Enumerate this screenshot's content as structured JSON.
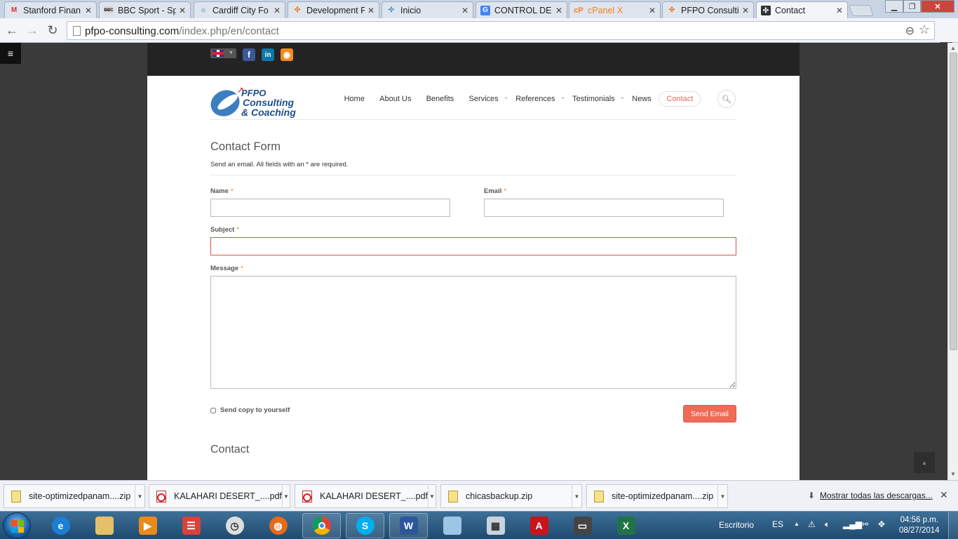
{
  "browser": {
    "tabs": [
      {
        "title": "Stanford Finan",
        "icon": "gmail-icon",
        "glyph": "M",
        "color": "#d93025",
        "active": false
      },
      {
        "title": "BBC Sport - Sp",
        "icon": "bbc-icon",
        "glyph": "BBC",
        "color": "#000000",
        "active": false
      },
      {
        "title": "Cardiff City Fo",
        "icon": "cardiff-icon",
        "glyph": "C",
        "color": "#2266aa",
        "active": false
      },
      {
        "title": "Development F",
        "icon": "joomla-icon",
        "glyph": "J",
        "color": "#e76f24",
        "active": false
      },
      {
        "title": "Inicio",
        "icon": "joomla-icon",
        "glyph": "J",
        "color": "#5091cd",
        "active": false
      },
      {
        "title": "CONTROL DE I",
        "icon": "google-icon",
        "glyph": "G",
        "color": "#4285f4",
        "active": false
      },
      {
        "title": "cPanel X",
        "icon": "cpanel-icon",
        "glyph": "cP",
        "color": "#f58220",
        "active": false
      },
      {
        "title": "PFPO Consultir",
        "icon": "joomla-icon",
        "glyph": "J",
        "color": "#e76f24",
        "active": false
      },
      {
        "title": "Contact",
        "icon": "joomla-icon",
        "glyph": "J",
        "color": "#333333",
        "active": true
      }
    ],
    "url_host": "pfpo-consulting.com",
    "url_path": "/index.php/en/contact"
  },
  "site": {
    "nav": [
      "Home",
      "About Us",
      "Benefits",
      "Services",
      "References",
      "Testimonials",
      "News",
      "Contact"
    ],
    "nav_active": "Contact",
    "logo": {
      "line1": "PFPO",
      "line2": "Consulting",
      "line3": "& Coaching"
    },
    "form": {
      "title": "Contact Form",
      "description": "Send an email. All fields with an * are required.",
      "name_label": "Name",
      "email_label": "Email",
      "subject_label": "Subject",
      "message_label": "Message",
      "required_mark": "*",
      "name_value": "",
      "email_value": "",
      "subject_value": "",
      "message_value": "",
      "copy_label": "Send copy to yourself",
      "send_label": "Send Email"
    },
    "contact_heading": "Contact"
  },
  "downloads": {
    "items": [
      {
        "name": "site-optimizedpanam....zip",
        "type": "zip"
      },
      {
        "name": "KALAHARI DESERT_....pdf",
        "type": "pdf"
      },
      {
        "name": "KALAHARI DESERT_....pdf",
        "type": "pdf"
      },
      {
        "name": "chicasbackup.zip",
        "type": "zip"
      },
      {
        "name": "site-optimizedpanam....zip",
        "type": "zip"
      }
    ],
    "show_all": "Mostrar todas las descargas..."
  },
  "taskbar": {
    "desktop_label": "Escritorio",
    "lang": "ES",
    "time": "04:56 p.m.",
    "date": "08/27/2014"
  },
  "colors": {
    "accent": "#ef6b58",
    "error_border": "#d9534f",
    "link_active": "#e9665b"
  }
}
